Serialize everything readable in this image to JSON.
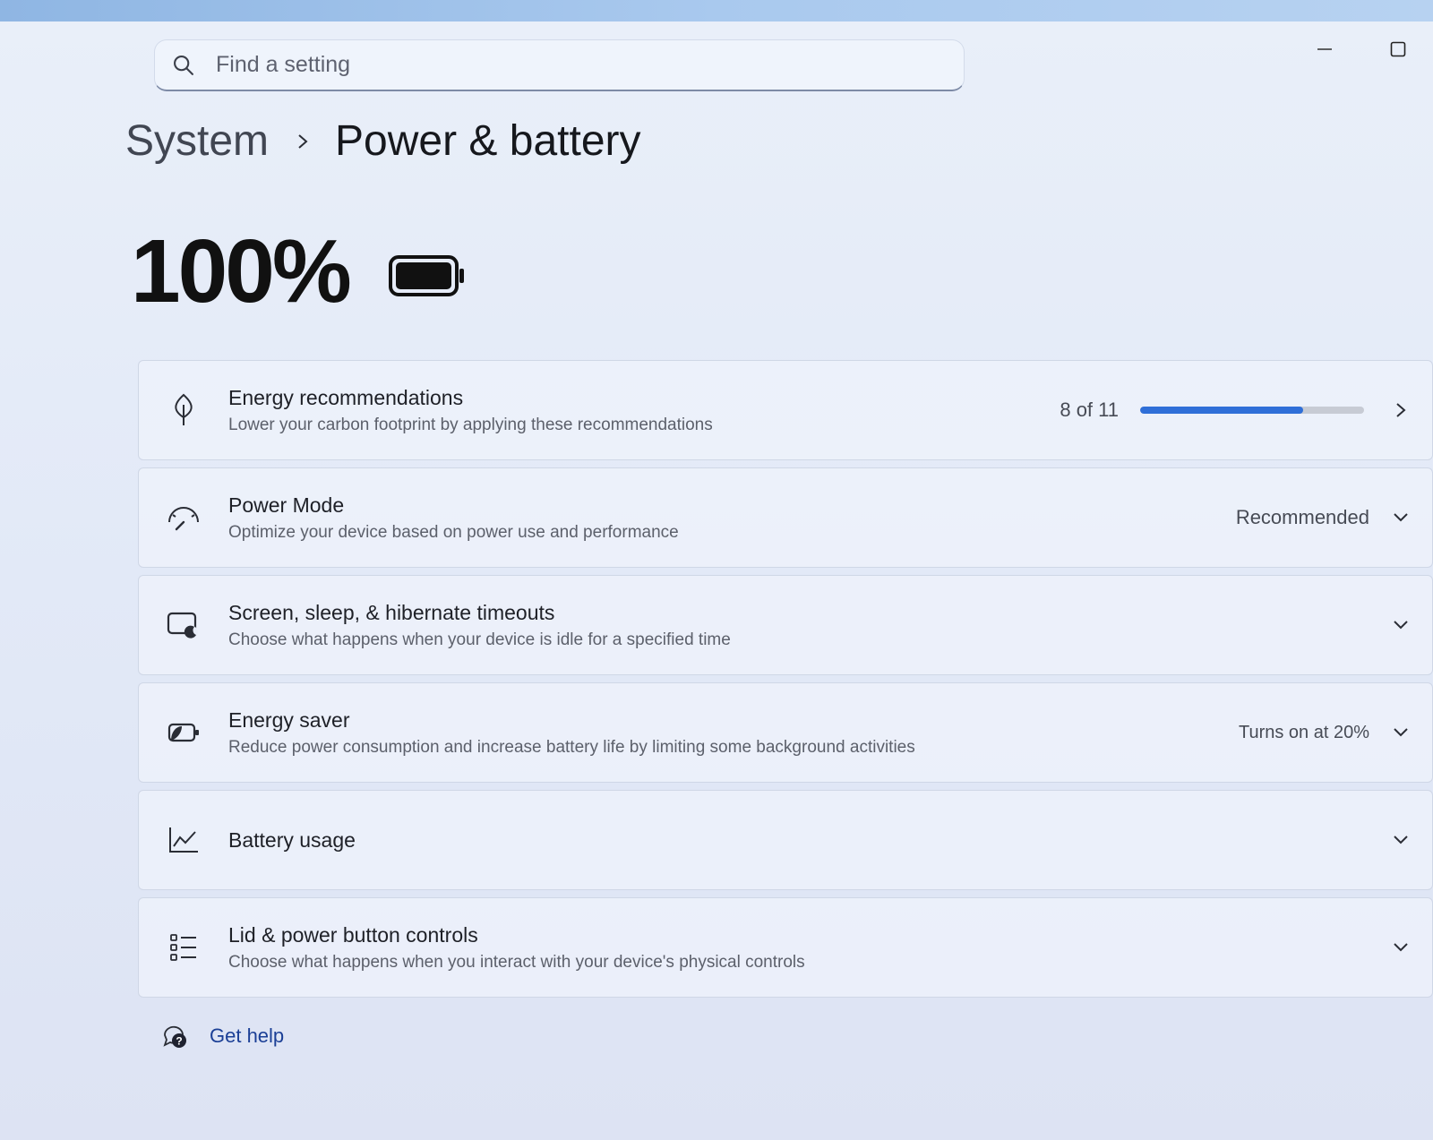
{
  "search": {
    "placeholder": "Find a setting",
    "value": ""
  },
  "breadcrumb": {
    "parent": "System",
    "current": "Power & battery"
  },
  "battery": {
    "percent_label": "100%",
    "level": 1.0
  },
  "items": [
    {
      "title": "Energy recommendations",
      "subtitle": "Lower your carbon footprint by applying these recommendations",
      "value": "8 of 11",
      "progress": 0.727,
      "icon": "leaf-icon",
      "action": "chevron-right-icon"
    },
    {
      "title": "Power Mode",
      "subtitle": "Optimize your device based on power use and performance",
      "value": "Recommended",
      "icon": "gauge-icon",
      "action": "chevron-down-icon"
    },
    {
      "title": "Screen, sleep, & hibernate timeouts",
      "subtitle": "Choose what happens when your device is idle for a specified time",
      "value": "",
      "icon": "screen-sleep-icon",
      "action": "chevron-down-icon"
    },
    {
      "title": "Energy saver",
      "subtitle": "Reduce power consumption and increase battery life by limiting some background activities",
      "value": "Turns on at 20%",
      "icon": "energy-saver-icon",
      "action": "chevron-down-icon"
    },
    {
      "title": "Battery usage",
      "subtitle": "",
      "value": "",
      "icon": "chart-line-icon",
      "action": "chevron-down-icon"
    },
    {
      "title": "Lid & power button controls",
      "subtitle": "Choose what happens when you interact with your device's physical controls",
      "value": "",
      "icon": "list-icon",
      "action": "chevron-down-icon"
    }
  ],
  "help": {
    "label": "Get help",
    "icon": "help-icon"
  },
  "colors": {
    "accent": "#2f6fd8",
    "link": "#1b3f96"
  }
}
